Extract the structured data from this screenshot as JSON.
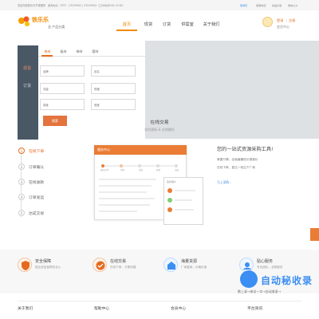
{
  "topbar": {
    "left_text": "欢迎光临铁乐乐不锈钢商平台",
    "phone_text": "服务热线：0757 - 23319942 / 23319943（工作时间9:00-17:00）",
    "links": [
      "登录买",
      "客服电话",
      "成品价格",
      "微信公众"
    ]
  },
  "header": {
    "brand": "U钢",
    "brand_text": "铁乐乐",
    "category_label": "全 产品分类",
    "nav": [
      "首页",
      "现货",
      "订货",
      "供需室",
      "关于我们"
    ],
    "user_links": [
      "登录",
      "注册"
    ],
    "user_center": "会员中心"
  },
  "hero": {
    "side_tabs": [
      "现货",
      "订货"
    ],
    "tabs": [
      "卷材",
      "板材",
      "带材",
      "管材"
    ],
    "fields": [
      [
        "品牌",
        "品名"
      ],
      [
        "流量",
        "规格"
      ],
      [
        "厚度",
        "宽度"
      ]
    ],
    "search_button": "搜索",
    "trade_title": "在线交易",
    "trade_subtitle": "实时更新 & 在线撮合"
  },
  "steps": [
    {
      "num": "1",
      "label": "在线下单"
    },
    {
      "num": "2",
      "label": "订单确认"
    },
    {
      "num": "3",
      "label": "在线收款"
    },
    {
      "num": "4",
      "label": "订单发运"
    },
    {
      "num": "5",
      "label": "达成交易"
    }
  ],
  "mock": {
    "window_title": "服务中心",
    "card_title": "签约客户",
    "mini_labels": [
      "提交订单",
      "付款",
      "发货",
      "收货",
      "完成"
    ]
  },
  "promo": {
    "title": "您的一站式资源采购工具!",
    "line1": "掌握行情，全面遍最低价源报价",
    "line2": "在线下单，直达一线生产厂商",
    "link": "马上采购 ›"
  },
  "features": [
    {
      "title": "安全保障",
      "desc": "国企资金保障安全心"
    },
    {
      "title": "在线交易",
      "desc": "在线下单，方便快捷"
    },
    {
      "title": "海量货源",
      "desc": "厂家直销，价格优惠"
    },
    {
      "title": "贴心服务",
      "desc": "专业团队，全程服务"
    }
  ],
  "footer": {
    "columns": [
      "关于我们",
      "帮助中心",
      "会员中心",
      "平台资讯"
    ]
  },
  "watermark": {
    "brand": "自动秘收录",
    "sub": "数上录→来访一次→自动收录→"
  },
  "colors": {
    "accent": "#E46A1F",
    "panel": "#4A5866",
    "blue": "#3B8EF2"
  },
  "icons": {
    "feature_icons": [
      "shield-icon",
      "trade-icon",
      "warehouse-icon",
      "service-icon"
    ]
  }
}
